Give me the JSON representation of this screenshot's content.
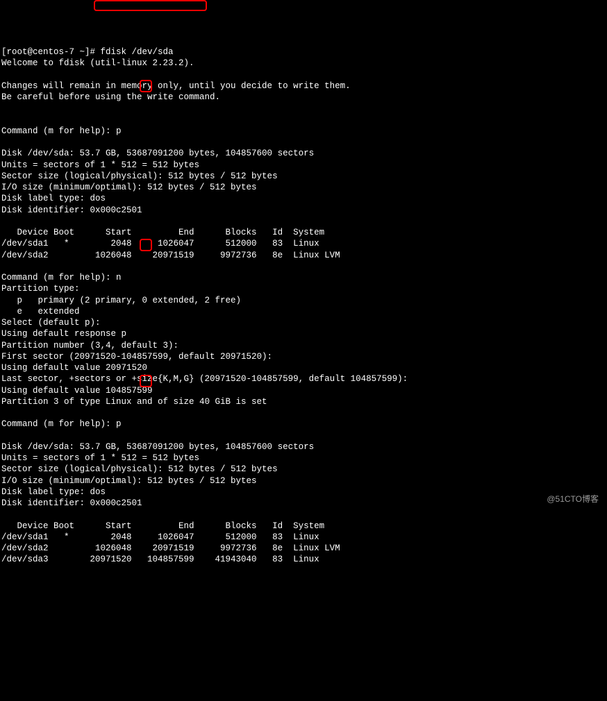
{
  "prompt_line": "[root@centos-7 ~]# fdisk /dev/sda",
  "welcome": "Welcome to fdisk (util-linux 2.23.2).",
  "changes_warning": "Changes will remain in memory only, until you decide to write them.",
  "becareful": "Be careful before using the write command.",
  "cmd_prompt": "Command (m for help): ",
  "input_p": "p",
  "input_n": "n",
  "disk_info_1": "Disk /dev/sda: 53.7 GB, 53687091200 bytes, 104857600 sectors",
  "units": "Units = sectors of 1 * 512 = 512 bytes",
  "sector_size": "Sector size (logical/physical): 512 bytes / 512 bytes",
  "io_size": "I/O size (minimum/optimal): 512 bytes / 512 bytes",
  "disk_label": "Disk label type: dos",
  "disk_id": "Disk identifier: 0x000c2501",
  "table_header": "   Device Boot      Start         End      Blocks   Id  System",
  "table1_row1": "/dev/sda1   *        2048     1026047      512000   83  Linux",
  "table1_row2": "/dev/sda2         1026048    20971519     9972736   8e  Linux LVM",
  "partition_type": "Partition type:",
  "ptype_primary": "   p   primary (2 primary, 0 extended, 2 free)",
  "ptype_extended": "   e   extended",
  "select_default": "Select (default p):",
  "using_default_p": "Using default response p",
  "partition_number": "Partition number (3,4, default 3):",
  "first_sector": "First sector (20971520-104857599, default 20971520):",
  "using_default_first": "Using default value 20971520",
  "last_sector": "Last sector, +sectors or +size{K,M,G} (20971520-104857599, default 104857599):",
  "using_default_last": "Using default value 104857599",
  "partition_set": "Partition 3 of type Linux and of size 40 GiB is set",
  "table2_row1": "/dev/sda1   *        2048     1026047      512000   83  Linux",
  "table2_row2": "/dev/sda2         1026048    20971519     9972736   8e  Linux LVM",
  "table2_row3": "/dev/sda3        20971520   104857599    41943040   83  Linux",
  "watermark_text": "@51CTO博客"
}
